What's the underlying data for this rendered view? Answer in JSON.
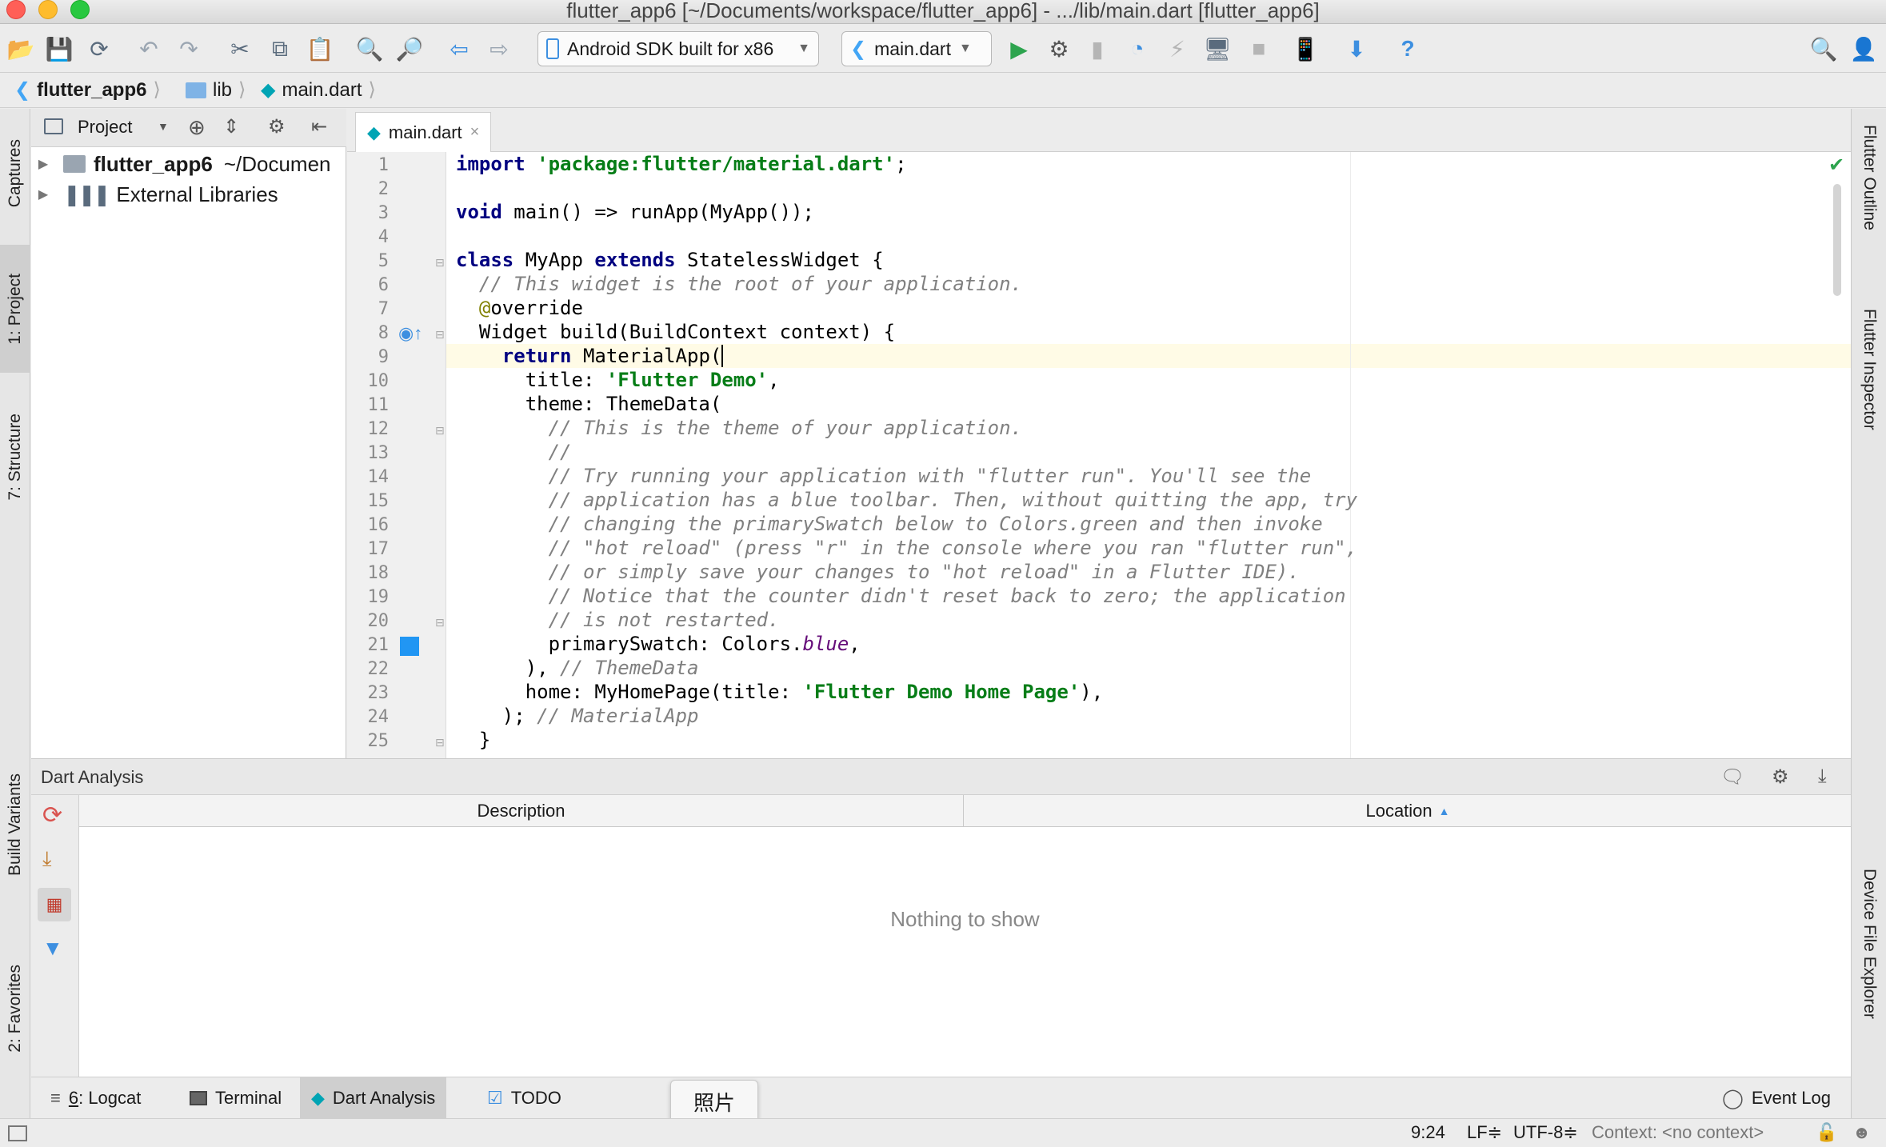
{
  "window": {
    "title": "flutter_app6 [~/Documents/workspace/flutter_app6] - .../lib/main.dart [flutter_app6]"
  },
  "toolbar": {
    "device_selector": "Android SDK built for x86",
    "run_config": "main.dart"
  },
  "breadcrumb": {
    "items": [
      "flutter_app6",
      "lib",
      "main.dart"
    ]
  },
  "left_tabs": {
    "captures": "Captures",
    "project": "1: Project",
    "structure": "7: Structure",
    "build_variants": "Build Variants",
    "favorites": "2: Favorites"
  },
  "right_tabs": {
    "flutter_outline": "Flutter Outline",
    "flutter_inspector": "Flutter Inspector",
    "device_file_explorer": "Device File Explorer"
  },
  "project_panel": {
    "view_mode": "Project",
    "tree": [
      {
        "name": "flutter_app6",
        "path": "~/Documen"
      },
      {
        "name": "External Libraries"
      }
    ]
  },
  "editor": {
    "tab": "main.dart",
    "line_numbers": [
      "1",
      "2",
      "3",
      "4",
      "5",
      "6",
      "7",
      "8",
      "9",
      "10",
      "11",
      "12",
      "13",
      "14",
      "15",
      "16",
      "17",
      "18",
      "19",
      "20",
      "21",
      "22",
      "23",
      "24",
      "25"
    ]
  },
  "dart_analysis": {
    "title": "Dart Analysis",
    "col_description": "Description",
    "col_location": "Location",
    "empty": "Nothing to show"
  },
  "tool_windows": {
    "logcat_num": "6",
    "logcat": ": Logcat",
    "terminal": "Terminal",
    "dart_analysis": "Dart Analysis",
    "todo": "TODO",
    "event_log": "Event Log"
  },
  "tooltip": "照片",
  "status": {
    "position": "9:24",
    "line_sep": "LF≑",
    "encoding": "UTF-8≑",
    "context": "Context: <no context>"
  },
  "colors": {
    "keyword": "#000080",
    "string": "#067d17",
    "comment": "#808080",
    "current_line": "#fffbe6",
    "swatch_blue": "#2196f3"
  }
}
